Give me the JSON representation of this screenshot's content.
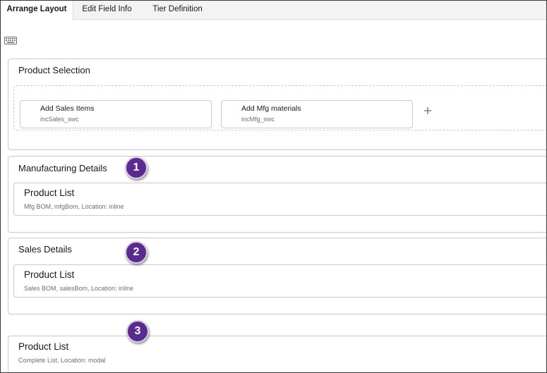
{
  "tabs": [
    {
      "label": "Arrange Layout",
      "active": true
    },
    {
      "label": "Edit Field Info",
      "active": false
    },
    {
      "label": "Tier Definition",
      "active": false
    }
  ],
  "icons": {
    "keyboard": "keyboard-icon",
    "add": "plus-icon"
  },
  "product_selection": {
    "title": "Product Selection",
    "items": [
      {
        "title": "Add Sales Items",
        "subtitle": "incSales_swc"
      },
      {
        "title": "Add Mfg materials",
        "subtitle": "incMfg_swc"
      }
    ]
  },
  "manufacturing": {
    "title": "Manufacturing Details",
    "list": {
      "title": "Product List",
      "subtitle": "Mfg BOM, mfgBom, Location: inline"
    }
  },
  "sales": {
    "title": "Sales Details",
    "list": {
      "title": "Product List",
      "subtitle": "Sales BOM, salesBom, Location: inline"
    }
  },
  "complete_list": {
    "title": "Product List",
    "subtitle": "Complete List, Location: modal"
  },
  "callouts": [
    "1",
    "2",
    "3"
  ],
  "colors": {
    "callout_bg": "#5a2a8c",
    "border": "#c9c9c9",
    "tabbar_bg": "#f3f3f3",
    "muted_text": "#706e6b"
  }
}
